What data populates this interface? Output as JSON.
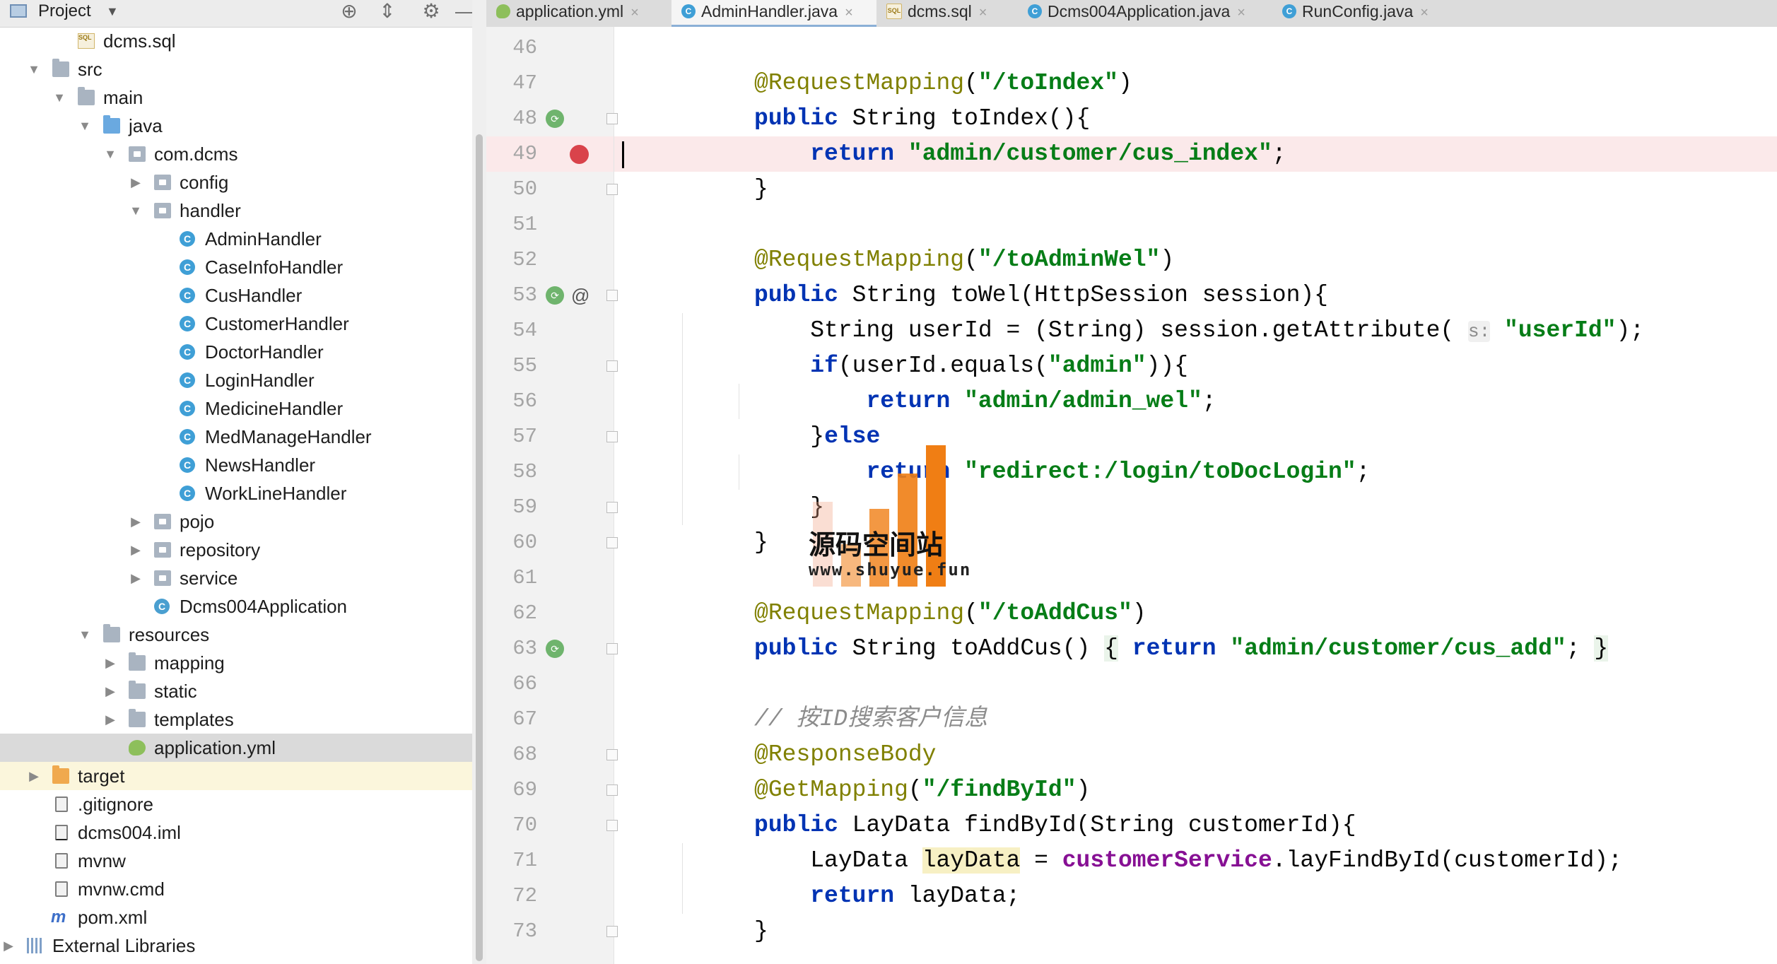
{
  "project_panel": {
    "title": "Project",
    "dropdown_glyph": "▼",
    "tools": [
      "crosshair-icon",
      "collapse-icon",
      "gear-icon",
      "minimize-icon"
    ]
  },
  "tree": [
    {
      "label": "dcms.sql",
      "icon": "sql-file-icon"
    },
    {
      "label": "src",
      "icon": "folder-icon",
      "arrow": "▼"
    },
    {
      "label": "main",
      "icon": "folder-icon",
      "arrow": "▼"
    },
    {
      "label": "java",
      "icon": "source-folder-icon",
      "arrow": "▼"
    },
    {
      "label": "com.dcms",
      "icon": "package-icon",
      "arrow": "▼"
    },
    {
      "label": "config",
      "icon": "package-icon",
      "arrow": "▶"
    },
    {
      "label": "handler",
      "icon": "package-icon",
      "arrow": "▼"
    },
    {
      "label": "AdminHandler",
      "icon": "class-icon"
    },
    {
      "label": "CaseInfoHandler",
      "icon": "class-icon"
    },
    {
      "label": "CusHandler",
      "icon": "class-icon"
    },
    {
      "label": "CustomerHandler",
      "icon": "class-icon"
    },
    {
      "label": "DoctorHandler",
      "icon": "class-icon"
    },
    {
      "label": "LoginHandler",
      "icon": "class-icon"
    },
    {
      "label": "MedicineHandler",
      "icon": "class-icon"
    },
    {
      "label": "MedManageHandler",
      "icon": "class-icon"
    },
    {
      "label": "NewsHandler",
      "icon": "class-icon"
    },
    {
      "label": "WorkLineHandler",
      "icon": "class-icon"
    },
    {
      "label": "pojo",
      "icon": "package-icon",
      "arrow": "▶"
    },
    {
      "label": "repository",
      "icon": "package-icon",
      "arrow": "▶"
    },
    {
      "label": "service",
      "icon": "package-icon",
      "arrow": "▶"
    },
    {
      "label": "Dcms004Application",
      "icon": "spring-class-icon"
    },
    {
      "label": "resources",
      "icon": "resources-folder-icon",
      "arrow": "▼"
    },
    {
      "label": "mapping",
      "icon": "folder-icon",
      "arrow": "▶"
    },
    {
      "label": "static",
      "icon": "folder-icon",
      "arrow": "▶"
    },
    {
      "label": "templates",
      "icon": "folder-icon",
      "arrow": "▶"
    },
    {
      "label": "application.yml",
      "icon": "yml-file-icon",
      "state": "selected"
    },
    {
      "label": "target",
      "icon": "excluded-folder-icon",
      "arrow": "▶",
      "state": "highlight"
    },
    {
      "label": ".gitignore",
      "icon": "text-file-icon"
    },
    {
      "label": "dcms004.iml",
      "icon": "iml-file-icon"
    },
    {
      "label": "mvnw",
      "icon": "text-file-icon"
    },
    {
      "label": "mvnw.cmd",
      "icon": "text-file-icon"
    },
    {
      "label": "pom.xml",
      "icon": "maven-file-icon"
    },
    {
      "label": "External Libraries",
      "icon": "libraries-icon",
      "arrow": "▶"
    }
  ],
  "tabs": [
    {
      "label": "application.yml",
      "icon": "yml-file-icon",
      "close": "×"
    },
    {
      "label": "AdminHandler.java",
      "icon": "class-icon",
      "close": "×",
      "active": true
    },
    {
      "label": "dcms.sql",
      "icon": "sql-file-icon",
      "close": "×"
    },
    {
      "label": "Dcms004Application.java",
      "icon": "class-icon",
      "close": "×"
    },
    {
      "label": "RunConfig.java",
      "icon": "class-icon",
      "close": "×"
    }
  ],
  "line_numbers": [
    "46",
    "47",
    "48",
    "49",
    "50",
    "51",
    "52",
    "53",
    "54",
    "55",
    "56",
    "57",
    "58",
    "59",
    "60",
    "61",
    "62",
    "63",
    "66",
    "67",
    "68",
    "69",
    "70",
    "71",
    "72",
    "73"
  ],
  "code": {
    "l47_ann": "@RequestMapping",
    "l47_p1": "(",
    "l47_str": "\"/toIndex\"",
    "l47_p2": ")",
    "l48_kw": "public",
    "l48_rest": " String toIndex(){",
    "l49_kw": "return",
    "l49_str": "\"admin/customer/cus_index\"",
    "l49_end": ";",
    "l50": "}",
    "l52_ann": "@RequestMapping",
    "l52_p1": "(",
    "l52_str": "\"/toAdminWel\"",
    "l52_p2": ")",
    "l53_kw": "public",
    "l53_rest": " String toWel(HttpSession session){",
    "l54_a": "String userId = (String) session.getAttribute(",
    "l54_hint": "s:",
    "l54_str": "\"userId\"",
    "l54_end": ");",
    "l55_kw": "if",
    "l55_a": "(userId.equals(",
    "l55_str": "\"admin\"",
    "l55_end": ")){",
    "l56_kw": "return",
    "l56_str": "\"admin/admin_wel\"",
    "l56_end": ";",
    "l57_a": "}",
    "l57_kw": "else",
    "l58_kw": "return",
    "l58_str": "\"redirect:/login/toDocLogin\"",
    "l58_end": ";",
    "l59": "}",
    "l60": "}",
    "l62_ann": "@RequestMapping",
    "l62_p1": "(",
    "l62_str": "\"/toAddCus\"",
    "l62_p2": ")",
    "l63_kw": "public",
    "l63_a": " String toAddCus() ",
    "l63_b1": "{",
    "l63_kw2": "return",
    "l63_str": "\"admin/customer/cus_add\"",
    "l63_end": ";",
    "l63_b2": "}",
    "l67": "// 按ID搜索客户信息",
    "l68": "@ResponseBody",
    "l69_ann": "@GetMapping",
    "l69_p1": "(",
    "l69_str": "\"/findById\"",
    "l69_p2": ")",
    "l70_kw": "public",
    "l70_rest": " LayData findById(String customerId){",
    "l71_a": "LayData ",
    "l71_var": "layData",
    "l71_b": " = ",
    "l71_fld": "customerService",
    "l71_c": ".layFindById(customerId);",
    "l72_kw": "return",
    "l72_rest": " layData;",
    "l73": "}"
  },
  "watermark": {
    "title": "源码空间站",
    "url": "www.shuyue.fun"
  },
  "colors": {
    "annotation": "#808000",
    "string": "#067d17",
    "keyword": "#0033b3",
    "breakpoint": "#d9434b",
    "watermark_orange": "#f07e14"
  }
}
